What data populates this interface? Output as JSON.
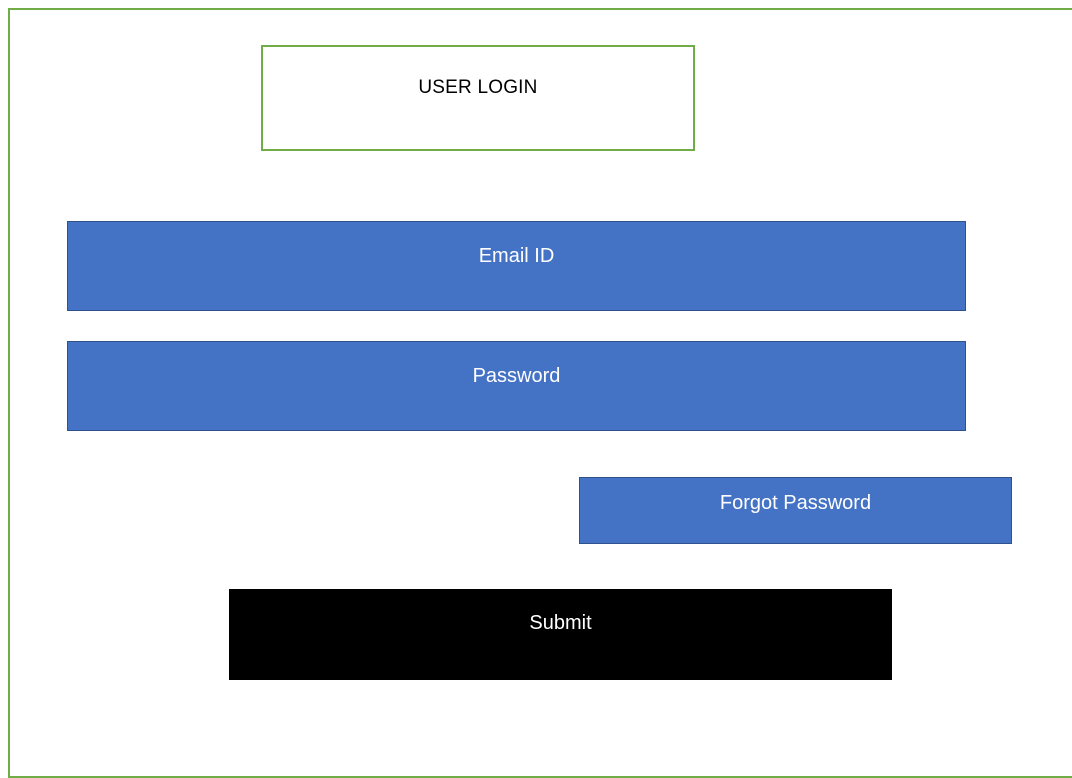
{
  "login": {
    "title": "USER LOGIN",
    "email_label": "Email ID",
    "password_label": "Password",
    "forgot_label": "Forgot Password",
    "submit_label": "Submit"
  },
  "colors": {
    "frame_border": "#70ad47",
    "field_fill": "#4472c4",
    "submit_fill": "#000000",
    "text_light": "#ffffff"
  }
}
